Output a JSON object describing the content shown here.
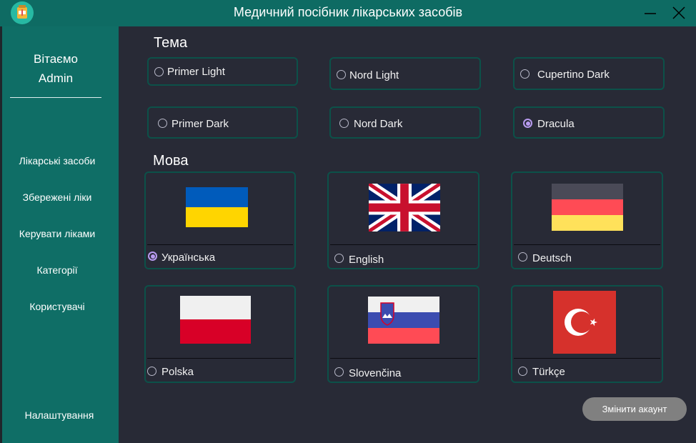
{
  "window": {
    "title": "Медичний посібник лікарських засобів",
    "icons": [
      "app-icon",
      "minimize-icon",
      "close-icon"
    ]
  },
  "sidebar": {
    "welcome_line1": "Вітаємо",
    "welcome_line2": "Admin",
    "items": [
      {
        "label": "Лікарські засоби"
      },
      {
        "label": "Збережені ліки"
      },
      {
        "label": "Керувати ліками"
      },
      {
        "label": "Категорії"
      },
      {
        "label": "Користувачі"
      }
    ],
    "settings_label": "Налаштування"
  },
  "theme": {
    "title": "Тема",
    "selected": "Dracula",
    "options": [
      {
        "label": "Primer Light",
        "checked": false
      },
      {
        "label": "Nord Light",
        "checked": false
      },
      {
        "label": "Cupertino Dark",
        "checked": false
      },
      {
        "label": "Primer Dark",
        "checked": false
      },
      {
        "label": "Nord Dark",
        "checked": false
      },
      {
        "label": "Dracula",
        "checked": true
      }
    ]
  },
  "language": {
    "title": "Мова",
    "selected": "Українська",
    "options": [
      {
        "label": "Українська",
        "flag": "ukraine-flag-icon",
        "checked": true
      },
      {
        "label": "English",
        "flag": "uk-flag-icon",
        "checked": false
      },
      {
        "label": "Deutsch",
        "flag": "germany-flag-icon",
        "checked": false
      },
      {
        "label": "Polska",
        "flag": "poland-flag-icon",
        "checked": false
      },
      {
        "label": "Slovenčina",
        "flag": "slovenia-flag-icon",
        "checked": false
      },
      {
        "label": "Türkçe",
        "flag": "turkey-flag-icon",
        "checked": false
      }
    ]
  },
  "footer": {
    "switch_account_label": "Змінити акаунт"
  },
  "colors": {
    "background": "#282a36",
    "accent": "#0f6e66",
    "border": "#0c5149",
    "radio_selected": "#b89bf0",
    "button": "#808080"
  }
}
